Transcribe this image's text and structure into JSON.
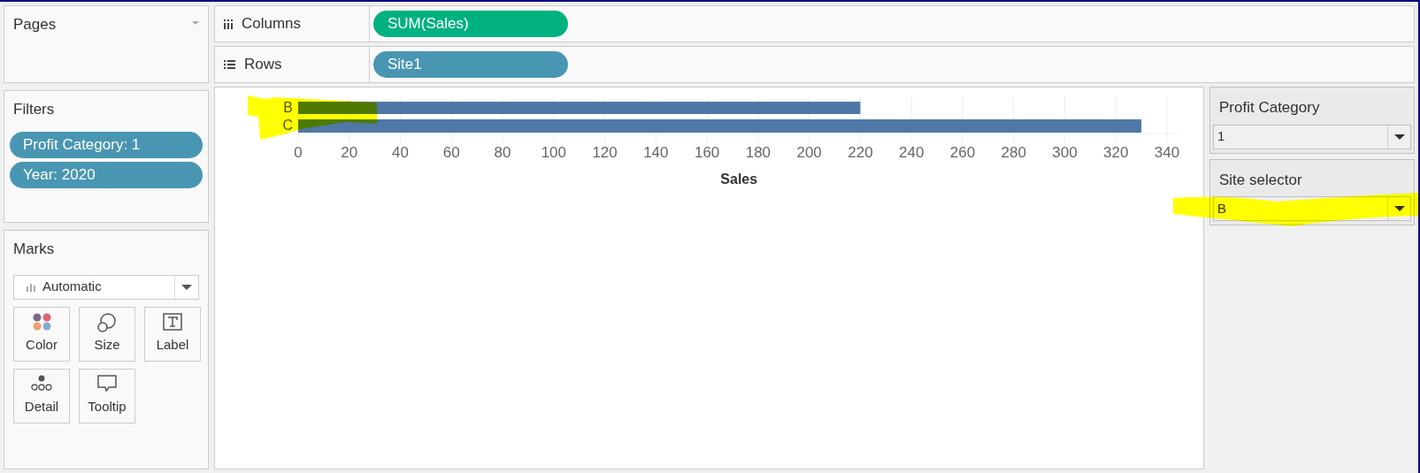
{
  "pages": {
    "title": "Pages"
  },
  "shelves": [
    {
      "kind": "columns",
      "label": "Columns",
      "pills": [
        {
          "text": "SUM(Sales)",
          "color": "#00b180"
        }
      ]
    },
    {
      "kind": "rows",
      "label": "Rows",
      "pills": [
        {
          "text": "Site1",
          "color": "#4996b2"
        }
      ]
    }
  ],
  "filters": {
    "title": "Filters",
    "pills": [
      {
        "text": "Profit Category: 1"
      },
      {
        "text": "Year: 2020"
      }
    ]
  },
  "marks": {
    "title": "Marks",
    "type": "Automatic",
    "cards": [
      {
        "kind": "color",
        "label": "Color"
      },
      {
        "kind": "size",
        "label": "Size"
      },
      {
        "kind": "label",
        "label": "Label"
      },
      {
        "kind": "detail",
        "label": "Detail"
      },
      {
        "kind": "tooltip",
        "label": "Tooltip"
      }
    ]
  },
  "chart": {
    "chart_data": {
      "type": "bar",
      "orientation": "horizontal",
      "grid": true,
      "xlabel": "Sales",
      "categories": [
        "B",
        "C"
      ],
      "values": [
        220,
        330
      ],
      "xlim": [
        0,
        345
      ],
      "xticks": [
        0,
        20,
        40,
        60,
        80,
        100,
        120,
        140,
        160,
        180,
        200,
        220,
        240,
        260,
        280,
        300,
        320,
        340
      ]
    }
  },
  "parameters": [
    {
      "title": "Profit Category",
      "value": "1"
    },
    {
      "title": "Site selector",
      "value": "B"
    }
  ]
}
